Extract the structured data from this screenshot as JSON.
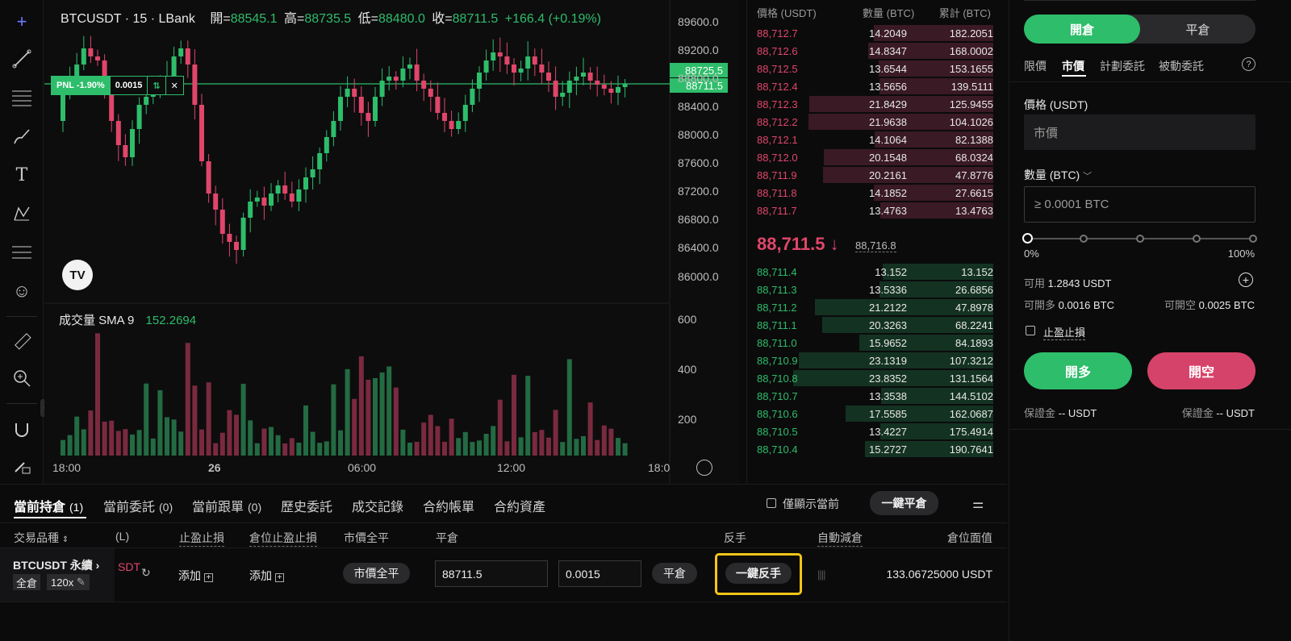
{
  "chart": {
    "symbol": "BTCUSDT · 15 · LBank",
    "open_label": "開=",
    "open": "88545.1",
    "high_label": "高=",
    "high": "88735.5",
    "low_label": "低=",
    "low": "88480.0",
    "close_label": "收=",
    "close": "88711.5",
    "change": "+166.4 (+0.19%)",
    "pnl": "PNL -1.90%",
    "position_qty": "0.0015",
    "price_tag_1": "88725.5",
    "price_tag_2": "88711.5",
    "y_ticks": [
      "89600.0",
      "89200.0",
      "88800.0",
      "88400.0",
      "88000.0",
      "87600.0",
      "87200.0",
      "86800.0",
      "86400.0",
      "86000.0"
    ],
    "vol_ticks": [
      "600",
      "400",
      "200"
    ],
    "x_ticks": [
      "18:00",
      "26",
      "06:00",
      "12:00",
      "18:0"
    ],
    "volume_label": "成交量 SMA 9",
    "volume_value": "152.2694",
    "logo": "TV"
  },
  "orderbook": {
    "headers": {
      "price": "價格 (USDT)",
      "qty": "數量 (BTC)",
      "total": "累計 (BTC)"
    },
    "asks": [
      {
        "price": "88,712.7",
        "qty": "14.2049",
        "total": "182.2051"
      },
      {
        "price": "88,712.6",
        "qty": "14.8347",
        "total": "168.0002"
      },
      {
        "price": "88,712.5",
        "qty": "13.6544",
        "total": "153.1655"
      },
      {
        "price": "88,712.4",
        "qty": "13.5656",
        "total": "139.5111"
      },
      {
        "price": "88,712.3",
        "qty": "21.8429",
        "total": "125.9455"
      },
      {
        "price": "88,712.2",
        "qty": "21.9638",
        "total": "104.1026"
      },
      {
        "price": "88,712.1",
        "qty": "14.1064",
        "total": "82.1388"
      },
      {
        "price": "88,712.0",
        "qty": "20.1548",
        "total": "68.0324"
      },
      {
        "price": "88,711.9",
        "qty": "20.2161",
        "total": "47.8776"
      },
      {
        "price": "88,711.8",
        "qty": "14.1852",
        "total": "27.6615"
      },
      {
        "price": "88,711.7",
        "qty": "13.4763",
        "total": "13.4763"
      }
    ],
    "last_price": "88,711.5",
    "last_arrow": "↓",
    "mark_price": "88,716.8",
    "bids": [
      {
        "price": "88,711.4",
        "qty": "13.152",
        "total": "13.152"
      },
      {
        "price": "88,711.3",
        "qty": "13.5336",
        "total": "26.6856"
      },
      {
        "price": "88,711.2",
        "qty": "21.2122",
        "total": "47.8978"
      },
      {
        "price": "88,711.1",
        "qty": "20.3263",
        "total": "68.2241"
      },
      {
        "price": "88,711.0",
        "qty": "15.9652",
        "total": "84.1893"
      },
      {
        "price": "88,710.9",
        "qty": "23.1319",
        "total": "107.3212"
      },
      {
        "price": "88,710.8",
        "qty": "23.8352",
        "total": "131.1564"
      },
      {
        "price": "88,710.7",
        "qty": "13.3538",
        "total": "144.5102"
      },
      {
        "price": "88,710.6",
        "qty": "17.5585",
        "total": "162.0687"
      },
      {
        "price": "88,710.5",
        "qty": "13.4227",
        "total": "175.4914"
      },
      {
        "price": "88,710.4",
        "qty": "15.2727",
        "total": "190.7641"
      }
    ]
  },
  "trade": {
    "open_tab": "開倉",
    "close_tab": "平倉",
    "order_types": [
      "限價",
      "市價",
      "計劃委託",
      "被動委託"
    ],
    "help": "?",
    "price_label": "價格 (USDT)",
    "price_value": "市價",
    "qty_label": "數量 (BTC)",
    "qty_placeholder": "≥ 0.0001 BTC",
    "slider_min": "0%",
    "slider_max": "100%",
    "slider_value": 0,
    "available_label": "可用",
    "available": "1.2843 USDT",
    "can_long_label": "可開多",
    "can_long": "0.0016 BTC",
    "can_short_label": "可開空",
    "can_short": "0.0025 BTC",
    "tpsl_label": "止盈止損",
    "long_button": "開多",
    "short_button": "開空",
    "margin_label_1": "保證金",
    "margin_value_1": "-- USDT",
    "margin_label_2": "保證金",
    "margin_value_2": "-- USDT"
  },
  "positions": {
    "tabs": [
      {
        "label": "當前持倉",
        "count": "(1)"
      },
      {
        "label": "當前委託",
        "count": "(0)"
      },
      {
        "label": "當前跟單",
        "count": "(0)"
      },
      {
        "label": "歷史委託",
        "count": ""
      },
      {
        "label": "成交記錄",
        "count": ""
      },
      {
        "label": "合約帳單",
        "count": ""
      },
      {
        "label": "合約資產",
        "count": ""
      }
    ],
    "show_current_label": "僅顯示當前",
    "close_all_button": "一鍵平倉",
    "columns": [
      "交易品種",
      "(L)",
      "止盈止損",
      "倉位止盈止損",
      "市價全平",
      "平倉",
      "反手",
      "自動減倉",
      "倉位面值"
    ],
    "row": {
      "symbol": "BTCUSDT 永續",
      "margin_mode": "全倉",
      "leverage": "120x",
      "pnl_fragment": "SDT",
      "tpsl_add": "添加",
      "pos_tpsl_add": "添加",
      "market_close": "市價全平",
      "close_price": "88711.5",
      "close_qty": "0.0015",
      "close_button": "平倉",
      "reverse_button": "一鍵反手",
      "value": "133.06725000 USDT"
    }
  },
  "colors": {
    "green": "#2ebd6a",
    "red": "#e0466a",
    "highlight": "#f5c518"
  }
}
